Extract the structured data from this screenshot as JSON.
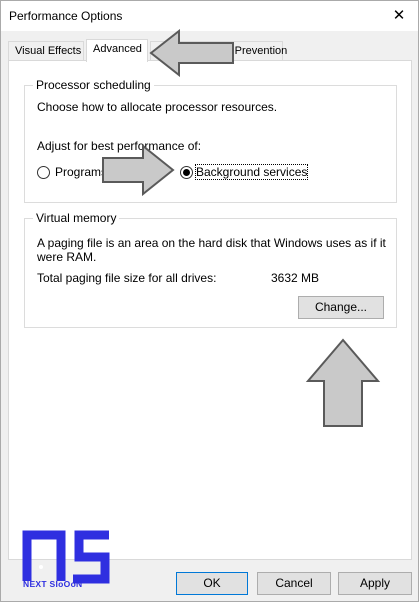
{
  "window": {
    "title": "Performance Options"
  },
  "tabs": [
    {
      "label": "Visual Effects"
    },
    {
      "label": "Advanced"
    },
    {
      "label": "Data Execution Prevention"
    }
  ],
  "processor": {
    "title": "Processor scheduling",
    "description": "Choose how to allocate processor resources.",
    "adjust_label": "Adjust for best performance of:",
    "option_programs": "Programs",
    "option_background": "Background services",
    "selected": "Background services"
  },
  "virtual_memory": {
    "title": "Virtual memory",
    "description_line1": "A paging file is an area on the hard disk that Windows uses as if it",
    "description_line2": "were RAM.",
    "total_label": "Total paging file size for all drives:",
    "total_value": "3632 MB",
    "change_button": "Change..."
  },
  "footer": {
    "ok": "OK",
    "cancel": "Cancel",
    "apply": "Apply"
  },
  "watermark": {
    "caption": "NEXT SIoOoN",
    "color": "#2f2fe0"
  }
}
